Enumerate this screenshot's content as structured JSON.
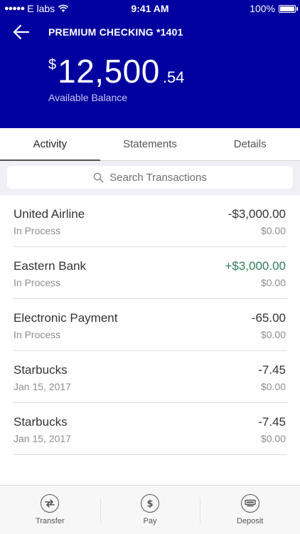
{
  "status_bar": {
    "carrier": "E labs",
    "time": "9:41 AM",
    "battery": "100%"
  },
  "header": {
    "title": "PREMIUM CHECKING *1401",
    "balance": {
      "currency": "$",
      "amount": "12,500",
      "cents": ".54",
      "label": "Available Balance"
    }
  },
  "tabs": [
    {
      "label": "Activity",
      "active": true
    },
    {
      "label": "Statements",
      "active": false
    },
    {
      "label": "Details",
      "active": false
    }
  ],
  "search": {
    "placeholder": "Search Transactions"
  },
  "transactions": [
    {
      "name": "United Airline",
      "status": "In Process",
      "amount": "-$3,000.00",
      "sub_amount": "$0.00"
    },
    {
      "name": "Eastern Bank",
      "status": "In Process",
      "amount": "+$3,000.00",
      "sub_amount": "$0.00"
    },
    {
      "name": "Electronic Payment",
      "status": "In Process",
      "amount": "-65.00",
      "sub_amount": "$0.00"
    },
    {
      "name": "Starbucks",
      "status": "Jan 15, 2017",
      "amount": "-7.45",
      "sub_amount": "$0.00"
    },
    {
      "name": "Starbucks",
      "status": "Jan 15, 2017",
      "amount": "-7.45",
      "sub_amount": "$0.00"
    }
  ],
  "tab_bar": {
    "items": [
      {
        "label": "Transfer",
        "icon": "transfer-icon"
      },
      {
        "label": "Pay",
        "icon": "pay-icon"
      },
      {
        "label": "Deposit",
        "icon": "deposit-icon"
      }
    ]
  },
  "colors": {
    "header_bg": "#0000a0",
    "positive_amount": "#2e7d5b"
  }
}
